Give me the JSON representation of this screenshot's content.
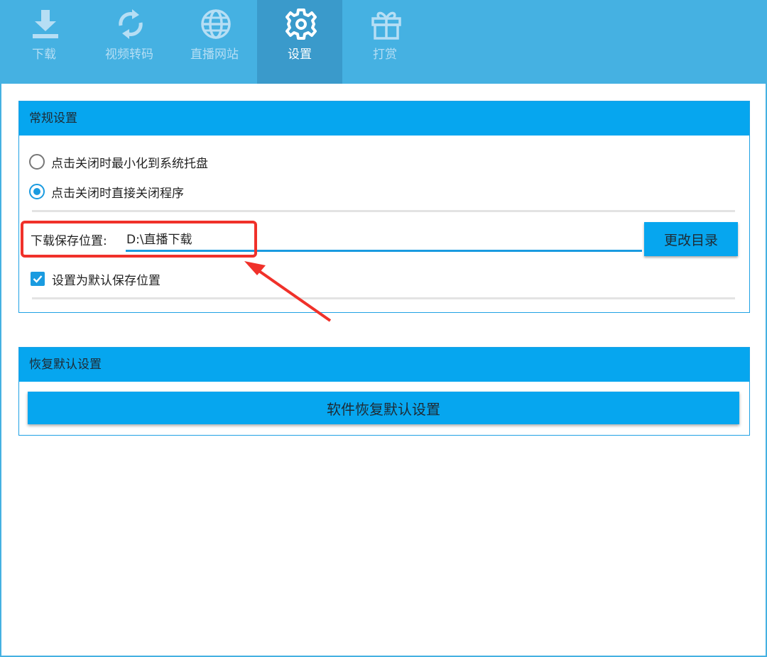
{
  "toolbar": {
    "tabs": [
      {
        "label": "下载",
        "icon": "download-icon"
      },
      {
        "label": "视频转码",
        "icon": "convert-icon"
      },
      {
        "label": "直播网站",
        "icon": "globe-icon"
      },
      {
        "label": "设置",
        "icon": "gear-icon",
        "active": true
      },
      {
        "label": "打赏",
        "icon": "gift-icon"
      }
    ]
  },
  "general": {
    "title": "常规设置",
    "close_options": [
      {
        "label": "点击关闭时最小化到系统托盘",
        "checked": false
      },
      {
        "label": "点击关闭时直接关闭程序",
        "checked": true
      }
    ],
    "path_label": "下载保存位置:",
    "path_value": "D:\\直播下载",
    "change_button": "更改目录",
    "default_checkbox": {
      "label": "设置为默认保存位置",
      "checked": true
    }
  },
  "restore": {
    "title": "恢复默认设置",
    "button": "软件恢复默认设置"
  },
  "colors": {
    "toolbar_bg": "#45b1e2",
    "active_tab_bg": "#3a9acb",
    "accent": "#06a6ef",
    "annotation": "#f0312a"
  }
}
